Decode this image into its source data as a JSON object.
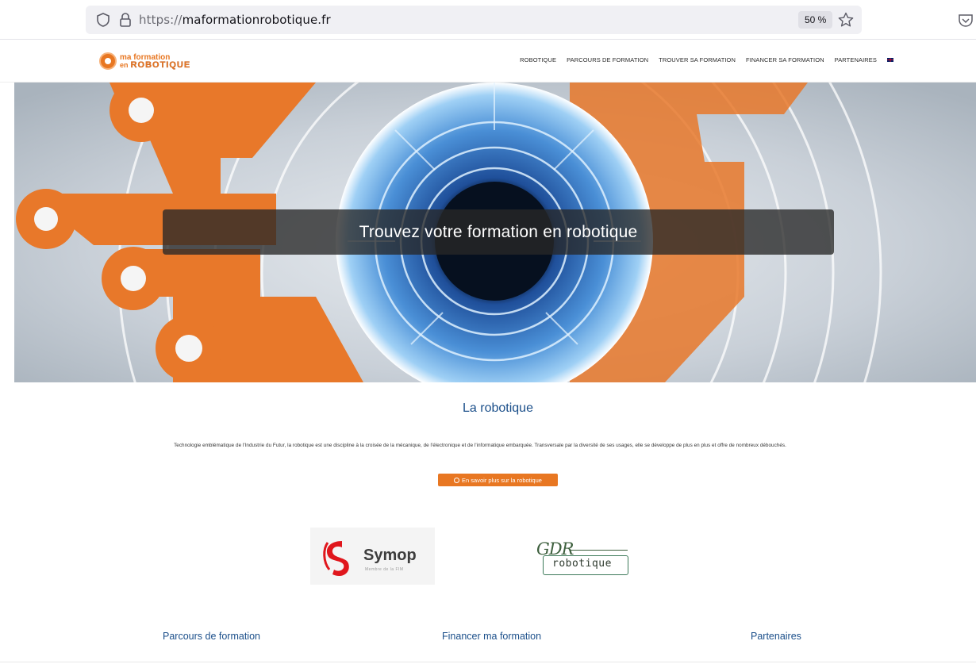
{
  "browser": {
    "url_protocol": "https://",
    "url_host": "maformationrobotique.fr",
    "zoom_label": "50 %",
    "icons": [
      "shield-icon",
      "lock-icon",
      "star-icon",
      "pocket-icon"
    ]
  },
  "site": {
    "logo": {
      "line1": "ma formation",
      "line2_prefix": "en",
      "line2_main": "ROBOTIQUE"
    },
    "nav": [
      "ROBOTIQUE",
      "PARCOURS DE FORMATION",
      "TROUVER SA FORMATION",
      "FINANCER SA FORMATION",
      "PARTENAIRES"
    ],
    "language_flag": "uk-flag-icon"
  },
  "hero": {
    "caption": "Trouvez votre formation en robotique"
  },
  "intro_section": {
    "title": "La robotique",
    "text": "Technologie emblématique de l'Industrie du Futur, la robotique est une discipline à la croisée de la mécanique, de l'électronique et de l'informatique embarquée. Transversale par la diversité de ses usages, elle se développe de plus en plus et offre de nombreux débouchés.",
    "button_label": "En savoir plus sur la robotique"
  },
  "partners": {
    "symop": {
      "name": "Symop",
      "subtitle": "Membre de la FIM"
    },
    "gdr": {
      "top": "GDR",
      "bottom": "robotique"
    }
  },
  "footer_links": [
    "Parcours de formation",
    "Financer ma formation",
    "Partenaires"
  ],
  "colors": {
    "accent": "#e87722",
    "link": "#1b4f8a",
    "caption_bg": "#282828"
  }
}
